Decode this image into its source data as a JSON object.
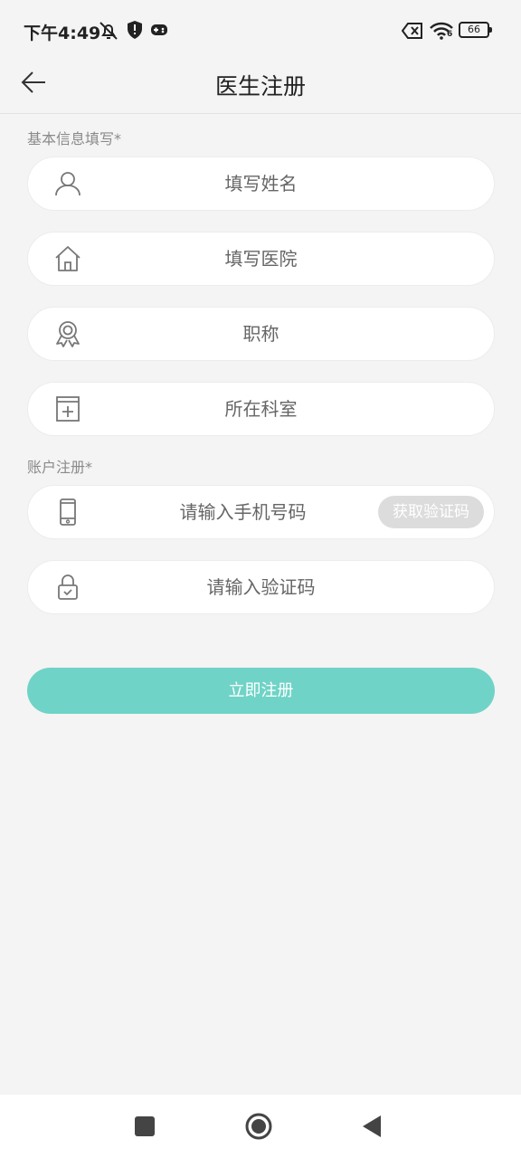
{
  "status_bar": {
    "time": "下午4:49",
    "battery": "66",
    "wifi_label": "6"
  },
  "header": {
    "title": "医生注册"
  },
  "basic_info": {
    "label": "基本信息填写*",
    "name_placeholder": "填写姓名",
    "hospital_placeholder": "填写医院",
    "title_placeholder": "职称",
    "department_placeholder": "所在科室"
  },
  "account": {
    "label": "账户注册*",
    "phone_placeholder": "请输入手机号码",
    "get_code_label": "获取验证码",
    "code_placeholder": "请输入验证码"
  },
  "submit_label": "立即注册",
  "colors": {
    "accent": "#70d3c7",
    "background": "#f4f4f4",
    "disabled_button": "#dcdcdc"
  },
  "icons": {
    "name": "user-icon",
    "hospital": "house-icon",
    "title": "award-badge-icon",
    "department": "medical-box-icon",
    "phone": "mobile-phone-icon",
    "code": "lock-icon"
  }
}
